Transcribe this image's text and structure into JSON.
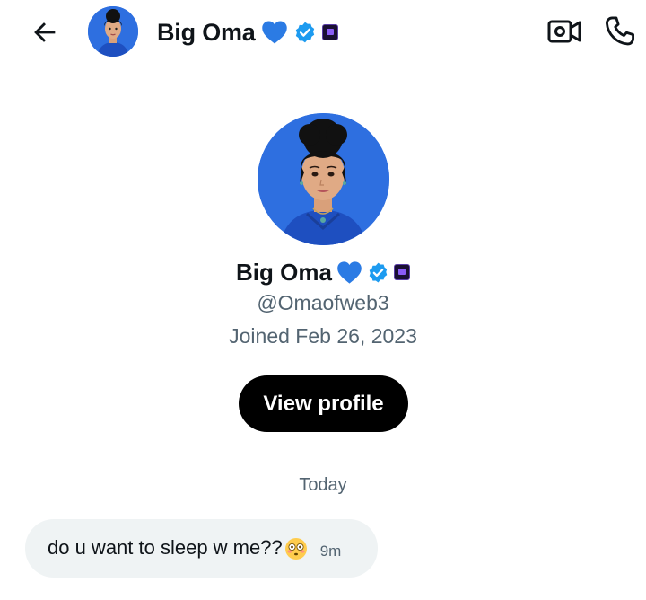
{
  "header": {
    "name": "Big Oma",
    "name_emoji": "heart-emoji-blue",
    "back_icon": "arrow-left-icon",
    "video_icon": "video-camera-icon",
    "call_icon": "phone-icon"
  },
  "profile": {
    "name": "Big Oma",
    "handle": "@Omaofweb3",
    "joined": "Joined Feb 26, 2023",
    "view_profile_label": "View profile"
  },
  "conversation": {
    "day_label": "Today",
    "messages": [
      {
        "text": "do u want to sleep w me??",
        "emoji": "flushed-face-emoji",
        "time": "9m"
      }
    ]
  },
  "colors": {
    "accent_blue": "#1d9bf0",
    "text_primary": "#0f1419",
    "text_secondary": "#536471",
    "bubble_bg": "#eff3f4",
    "button_bg": "#000000",
    "avatar_bg": "#2e6fe0"
  }
}
